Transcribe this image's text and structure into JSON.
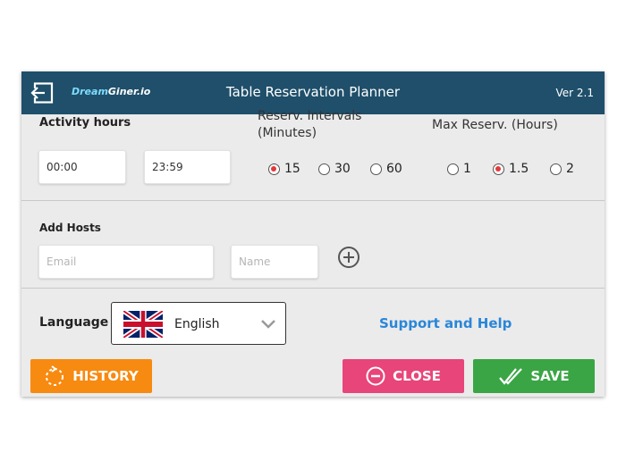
{
  "header": {
    "brand_part1": "Dream",
    "brand_part2": "Giner.io",
    "title": "Table Reservation Planner",
    "version": "Ver 2.1"
  },
  "activity_hours": {
    "label": "Activity hours",
    "start_value": "00:00",
    "end_value": "23:59"
  },
  "intervals": {
    "label_line1": "Reserv. Intervals",
    "label_line2": "(Minutes)",
    "options": [
      "15",
      "30",
      "60"
    ],
    "selected": "15"
  },
  "max_reserv": {
    "label": "Max Reserv. (Hours)",
    "options": [
      "1",
      "1.5",
      "2"
    ],
    "selected": "1.5"
  },
  "hosts": {
    "label": "Add Hosts",
    "email_placeholder": "Email",
    "name_placeholder": "Name"
  },
  "language": {
    "label": "Language",
    "selected": "English",
    "flag_icon": "uk-flag-icon"
  },
  "support": {
    "label": "Support and Help"
  },
  "actions": {
    "history_label": "HISTORY",
    "close_label": "CLOSE",
    "save_label": "SAVE"
  },
  "colors": {
    "header_bg": "#1f4f6a",
    "history": "#f78a10",
    "close": "#e8457a",
    "save": "#3aa544",
    "link": "#2a86d8",
    "radio_selected": "#e23a3a"
  }
}
